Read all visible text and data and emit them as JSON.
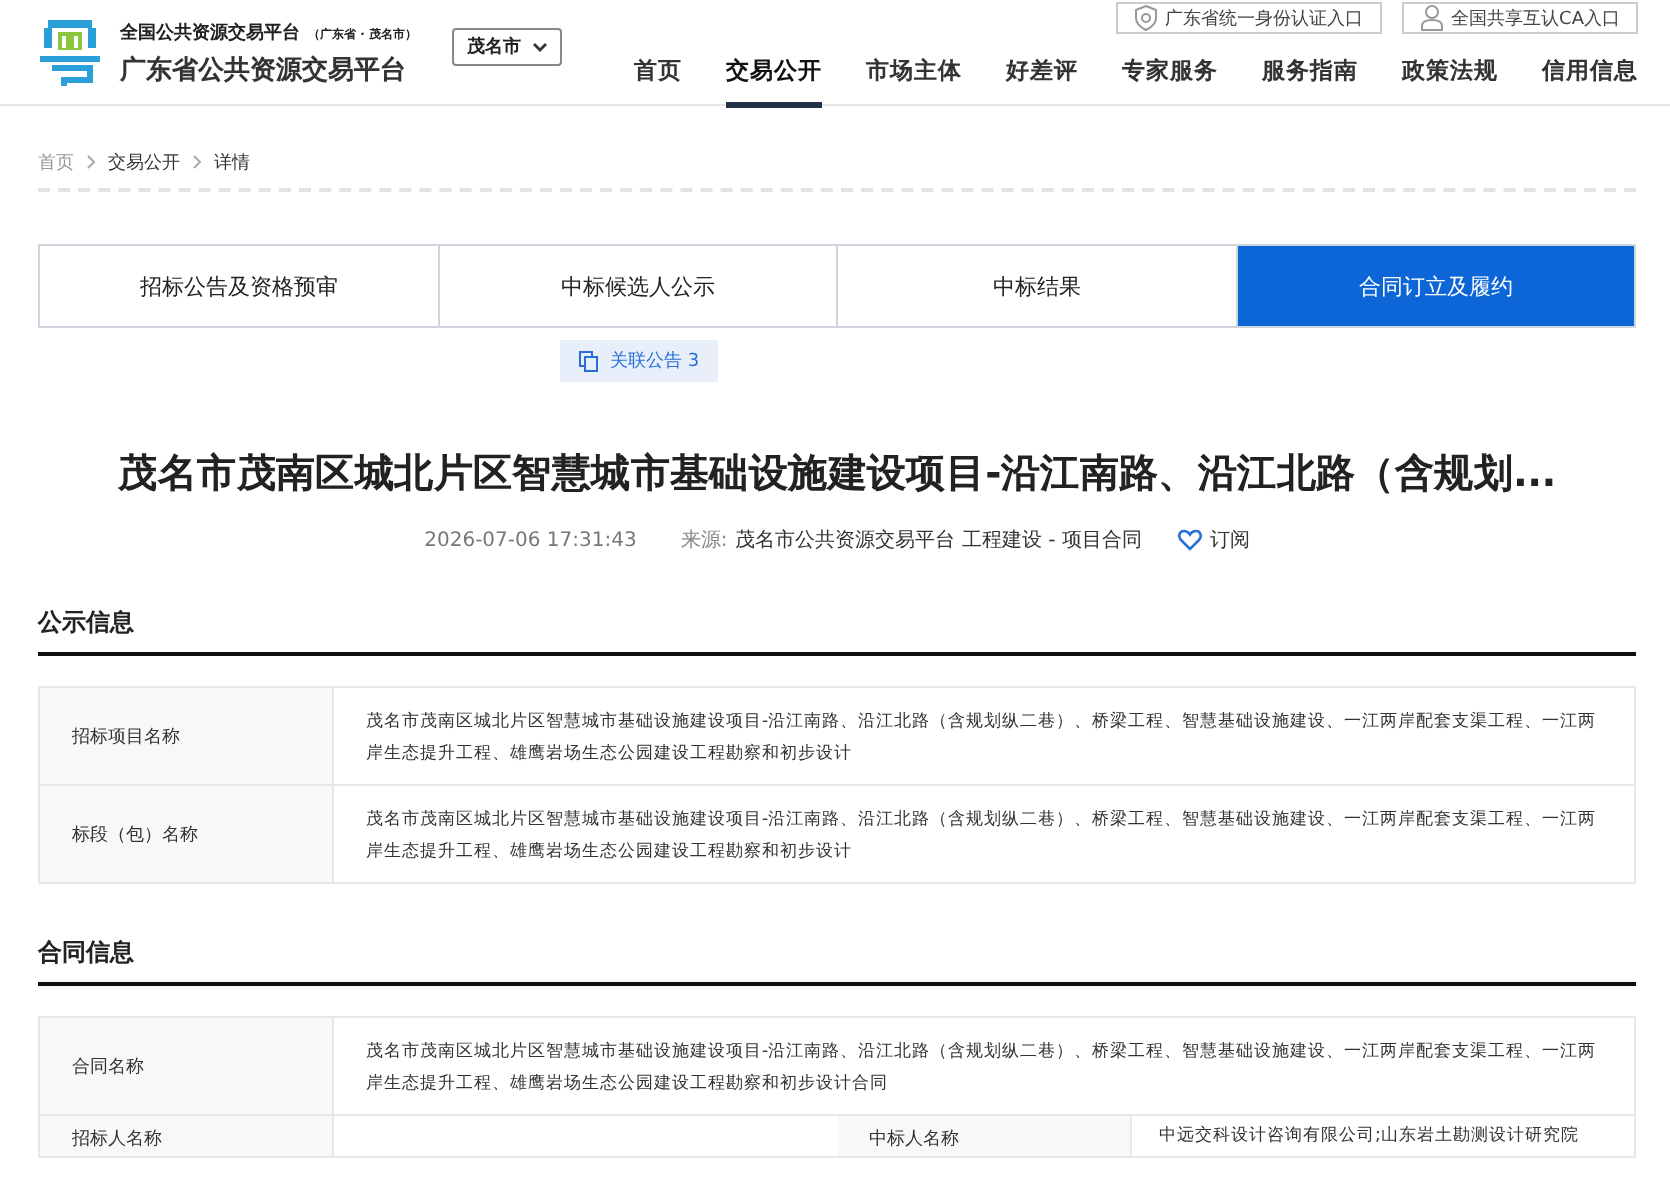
{
  "header": {
    "subtitle": "全国公共资源交易平台",
    "region_note": "（广东省 · 茂名市）",
    "title": "广东省公共资源交易平台",
    "city_select": "茂名市",
    "auth_links": [
      {
        "kind": "shield",
        "label": "广东省统一身份认证入口"
      },
      {
        "kind": "user",
        "label": "全国共享互认CA入口"
      }
    ],
    "nav": [
      {
        "label": "首页",
        "selected": false
      },
      {
        "label": "交易公开",
        "selected": true
      },
      {
        "label": "市场主体",
        "selected": false
      },
      {
        "label": "好差评",
        "selected": false
      },
      {
        "label": "专家服务",
        "selected": false
      },
      {
        "label": "服务指南",
        "selected": false
      },
      {
        "label": "政策法规",
        "selected": false
      },
      {
        "label": "信用信息",
        "selected": false
      }
    ]
  },
  "breadcrumb": [
    {
      "label": "首页"
    },
    {
      "label": "交易公开"
    },
    {
      "label": "详情"
    }
  ],
  "stage_tabs": [
    {
      "label": "招标公告及资格预审",
      "selected": false
    },
    {
      "label": "中标候选人公示",
      "selected": false
    },
    {
      "label": "中标结果",
      "selected": false
    },
    {
      "label": "合同订立及履约",
      "selected": true
    }
  ],
  "related_badge": "关联公告 3",
  "article": {
    "title": "茂名市茂南区城北片区智慧城市基础设施建设项目-沿江南路、沿江北路（含规划...",
    "time": "2026-07-06 17:31:43",
    "source_label": "来源:",
    "source": "茂名市公共资源交易平台 工程建设 - 项目合同",
    "subscribe": "订阅"
  },
  "sections": [
    {
      "title": "公示信息",
      "rows": [
        {
          "cells": [
            {
              "kind": "label",
              "text": "招标项目名称"
            },
            {
              "kind": "value",
              "text": "茂名市茂南区城北片区智慧城市基础设施建设项目-沿江南路、沿江北路（含规划纵二巷）、桥梁工程、智慧基础设施建设、一江两岸配套支渠工程、一江两岸生态提升工程、雄鹰岩场生态公园建设工程勘察和初步设计"
            }
          ]
        },
        {
          "cells": [
            {
              "kind": "label",
              "text": "标段（包）名称"
            },
            {
              "kind": "value",
              "text": "茂名市茂南区城北片区智慧城市基础设施建设项目-沿江南路、沿江北路（含规划纵二巷）、桥梁工程、智慧基础设施建设、一江两岸配套支渠工程、一江两岸生态提升工程、雄鹰岩场生态公园建设工程勘察和初步设计"
            }
          ]
        }
      ]
    },
    {
      "title": "合同信息",
      "rows": [
        {
          "cells": [
            {
              "kind": "label",
              "text": "合同名称"
            },
            {
              "kind": "value",
              "text": "茂名市茂南区城北片区智慧城市基础设施建设项目-沿江南路、沿江北路（含规划纵二巷）、桥梁工程、智慧基础设施建设、一江两岸配套支渠工程、一江两岸生态提升工程、雄鹰岩场生态公园建设工程勘察和初步设计合同"
            }
          ]
        },
        {
          "cells": [
            {
              "kind": "label",
              "text": "招标人名称"
            },
            {
              "kind": "value"
            },
            {
              "kind": "label",
              "text": "中标人名称"
            },
            {
              "kind": "value",
              "text": "中远交科设计咨询有限公司;山东岩土勘测设计研究院"
            }
          ]
        }
      ]
    }
  ]
}
